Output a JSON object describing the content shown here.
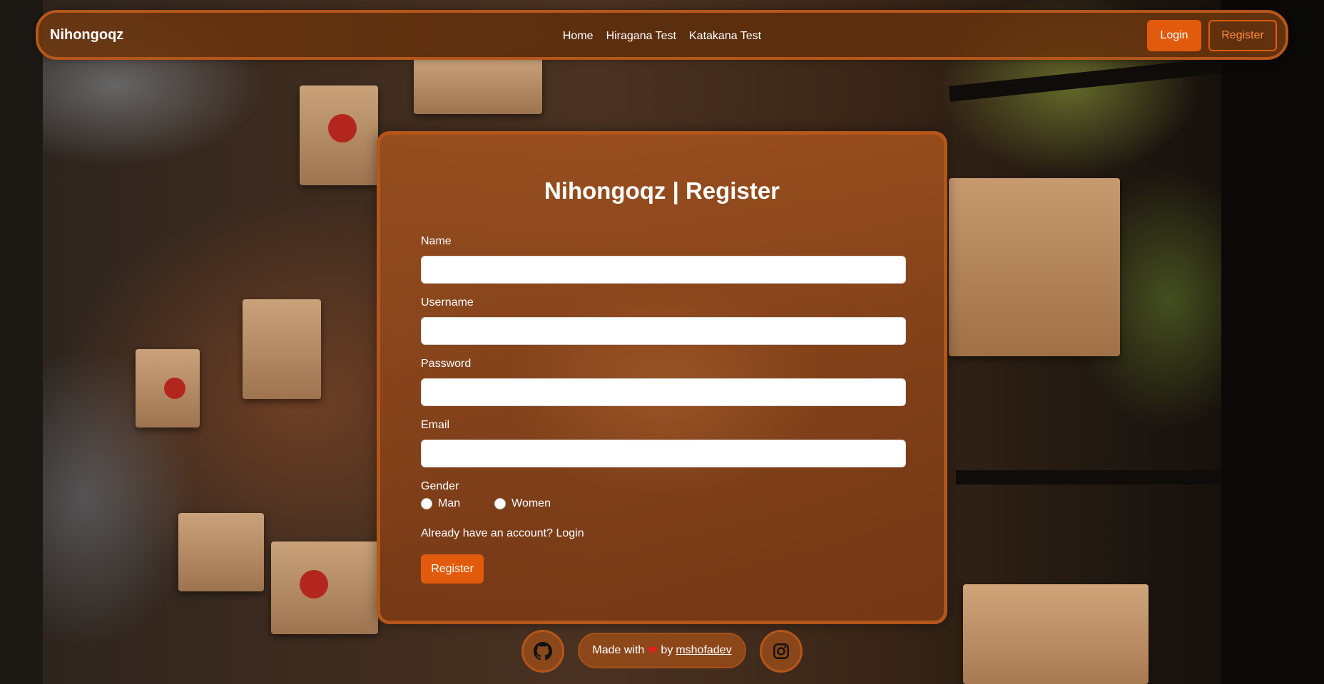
{
  "navbar": {
    "brand": "Nihongoqz",
    "links": [
      "Home",
      "Hiragana Test",
      "Katakana Test"
    ],
    "login_label": "Login",
    "register_label": "Register"
  },
  "form": {
    "title": "Nihongoqz | Register",
    "fields": {
      "name_label": "Name",
      "username_label": "Username",
      "password_label": "Password",
      "email_label": "Email"
    },
    "gender": {
      "label": "Gender",
      "options": [
        "Man",
        "Women"
      ]
    },
    "login_prompt": "Already have an account? Login",
    "submit_label": "Register"
  },
  "footer": {
    "made_with": "Made with",
    "by": "by",
    "author": "mshofadev",
    "heart": "❤"
  },
  "colors": {
    "accent": "#e25a0b",
    "border": "#b5561a"
  }
}
